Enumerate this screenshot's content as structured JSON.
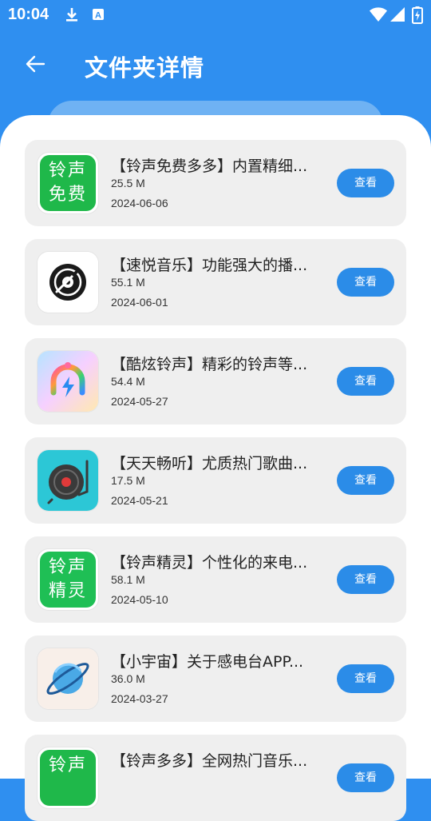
{
  "status_bar": {
    "time": "10:04"
  },
  "header": {
    "title": "文件夹详情"
  },
  "colors": {
    "primary": "#2f8ff0",
    "button": "#2b8ce8",
    "card_bg": "#efefef"
  },
  "items": [
    {
      "title": "【铃声免费多多】内置精细...",
      "size": "25.5 M",
      "date": "2024-06-06",
      "button": "查看",
      "icon": "ringtone-free-icon",
      "icon_text": [
        "铃声",
        "免费"
      ]
    },
    {
      "title": "【速悦音乐】功能强大的播...",
      "size": "55.1 M",
      "date": "2024-06-01",
      "button": "查看",
      "icon": "vinyl-disc-icon"
    },
    {
      "title": "【酷炫铃声】精彩的铃声等...",
      "size": "54.4 M",
      "date": "2024-05-27",
      "button": "查看",
      "icon": "rainbow-bell-icon"
    },
    {
      "title": "【天天畅听】尤质热门歌曲...",
      "size": "17.5 M",
      "date": "2024-05-21",
      "button": "查看",
      "icon": "record-player-icon"
    },
    {
      "title": "【铃声精灵】个性化的来电...",
      "size": "58.1 M",
      "date": "2024-05-10",
      "button": "查看",
      "icon": "ringtone-sprite-icon",
      "icon_text": [
        "铃声",
        "精灵"
      ]
    },
    {
      "title": "【小宇宙】关于感电台APP...",
      "size": "36.0 M",
      "date": "2024-03-27",
      "button": "查看",
      "icon": "planet-icon"
    },
    {
      "title": "【铃声多多】全网热门音乐...",
      "size": "",
      "date": "",
      "button": "查看",
      "icon": "ringtone-duoduo-icon",
      "icon_text": [
        "铃声"
      ]
    }
  ]
}
